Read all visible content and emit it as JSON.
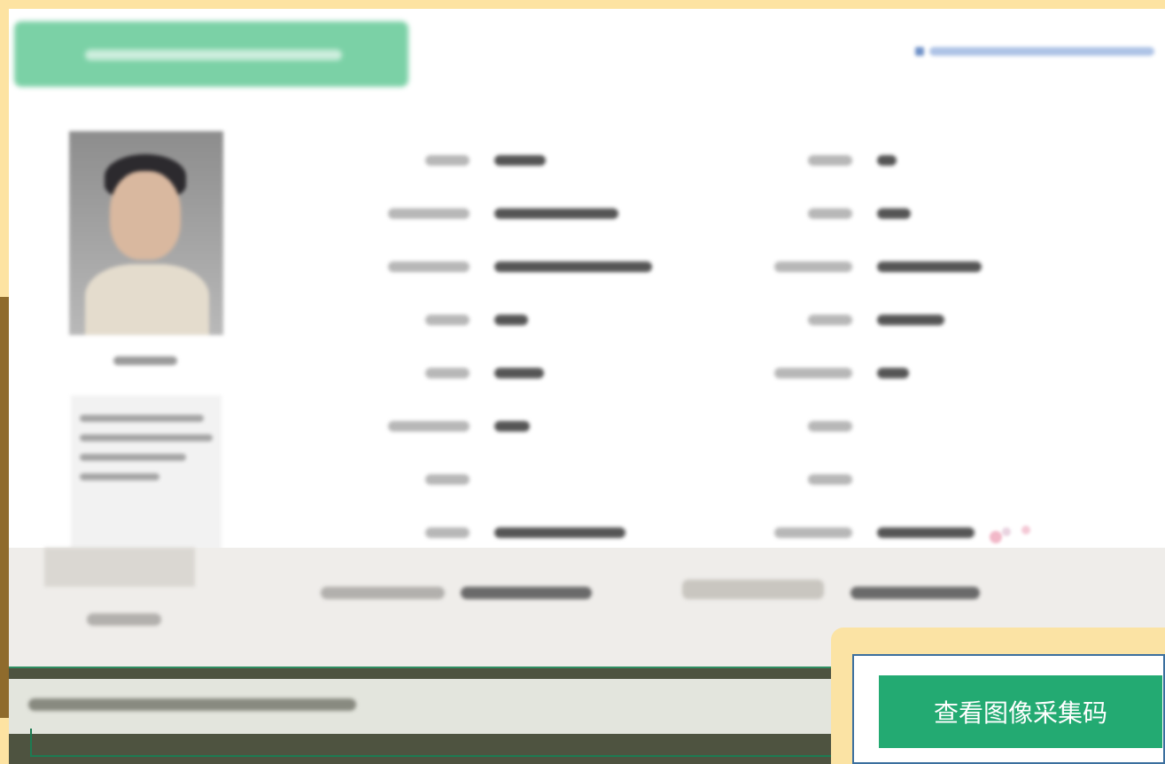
{
  "actions": {
    "view_image_collection_code": "查看图像采集码"
  },
  "colors": {
    "page_border": "#fde3a2",
    "primary_green": "#23aa72",
    "header_green": "#7bd1a6",
    "link_blue": "#6f91c8",
    "popup_border": "#3b6f9e"
  },
  "icons": {
    "top_link": "info-icon"
  }
}
